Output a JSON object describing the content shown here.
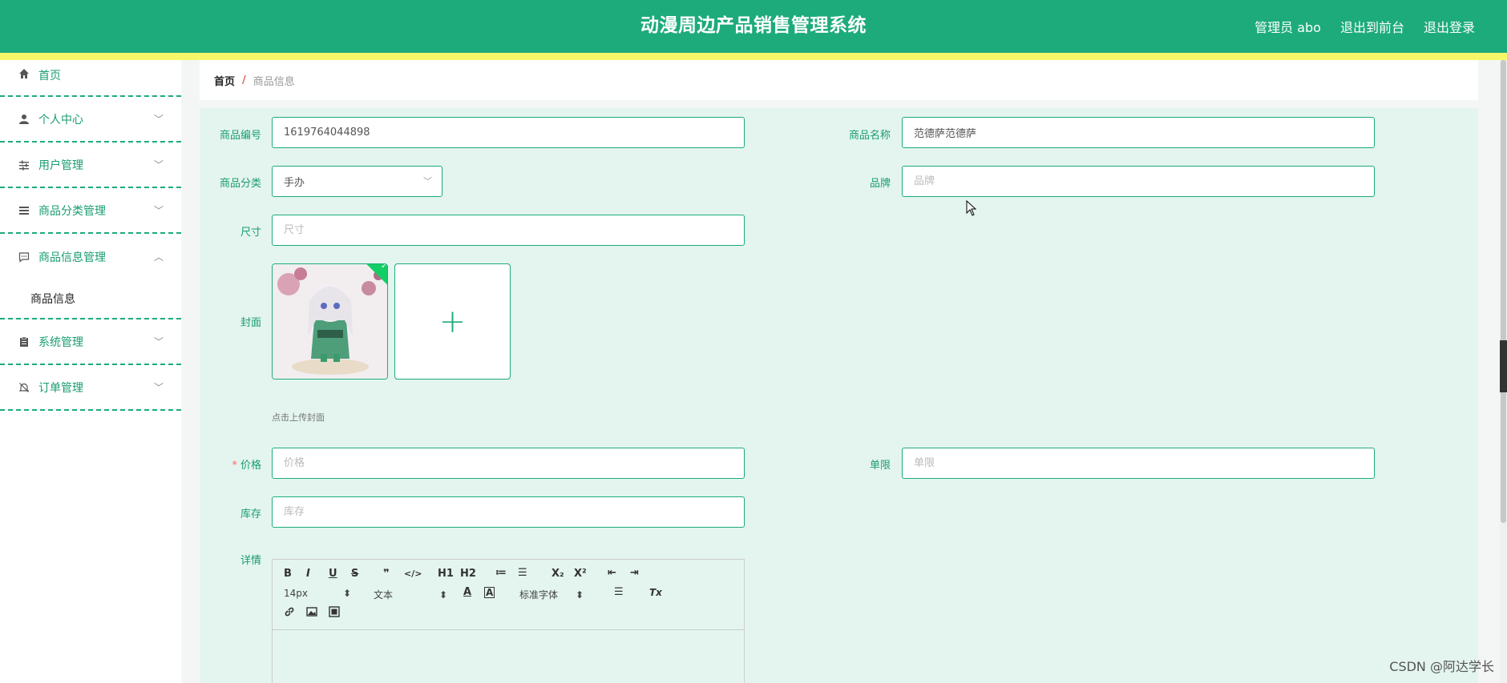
{
  "header": {
    "title": "动漫周边产品销售管理系统",
    "links": [
      "管理员 abo",
      "退出到前台",
      "退出登录"
    ]
  },
  "sidebar": {
    "items": [
      {
        "label": "首页",
        "icon": "home-icon"
      },
      {
        "label": "个人中心",
        "icon": "user-icon"
      },
      {
        "label": "用户管理",
        "icon": "sliders-icon"
      },
      {
        "label": "商品分类管理",
        "icon": "list-icon"
      },
      {
        "label": "商品信息管理",
        "icon": "chat-icon",
        "open": true,
        "children": [
          "商品信息"
        ]
      },
      {
        "label": "系统管理",
        "icon": "clipboard-icon"
      },
      {
        "label": "订单管理",
        "icon": "bell-off-icon"
      }
    ]
  },
  "breadcrumb": {
    "home": "首页",
    "separator": "/",
    "current": "商品信息"
  },
  "form": {
    "product_no": {
      "label": "商品编号",
      "value": "1619764044898"
    },
    "product_name": {
      "label": "商品名称",
      "value": "范德萨范德萨"
    },
    "category": {
      "label": "商品分类",
      "value": "手办"
    },
    "brand": {
      "label": "品牌",
      "placeholder": "品牌"
    },
    "size": {
      "label": "尺寸",
      "placeholder": "尺寸"
    },
    "cover": {
      "label": "封面",
      "tip": "点击上传封面",
      "add_symbol": "+"
    },
    "price": {
      "label": "价格",
      "required_mark": "*",
      "placeholder": "价格"
    },
    "limit": {
      "label": "单限",
      "placeholder": "单限"
    },
    "stock": {
      "label": "库存",
      "placeholder": "库存"
    },
    "details": {
      "label": "详情"
    }
  },
  "editor": {
    "row1": [
      "B",
      "I",
      "U",
      "S",
      "❞",
      "</>",
      "H1",
      "H2",
      "≔",
      "☰",
      "X₂",
      "X²",
      "⇤",
      "⇥"
    ],
    "font_size": "14px",
    "text_style": "文本",
    "font_family": "标准字体",
    "clear_format": "Tx"
  },
  "watermark": "CSDN @阿达学长",
  "colors": {
    "header": "#1dab7b",
    "stripe": "#f6f66a",
    "panel": "#e3f5ee",
    "accent": "#1dab7b"
  }
}
